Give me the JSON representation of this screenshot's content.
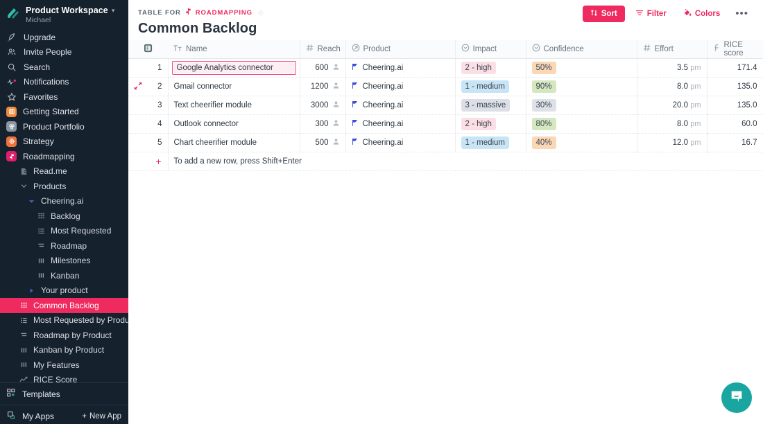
{
  "sidebar": {
    "workspace": {
      "title": "Product Workspace",
      "user": "Michael",
      "caret": "chevron-down-icon"
    },
    "nav": [
      {
        "label": "Upgrade",
        "icon": "rocket-icon"
      },
      {
        "label": "Invite People",
        "icon": "people-icon"
      },
      {
        "label": "Search",
        "icon": "search-icon"
      },
      {
        "label": "Notifications",
        "icon": "activity-icon"
      },
      {
        "label": "Favorites",
        "icon": "star-icon"
      }
    ],
    "apps": [
      {
        "label": "Getting Started",
        "icon": "book-icon",
        "color": "#f08a3c"
      },
      {
        "label": "Product Portfolio",
        "icon": "molecule-icon",
        "color": "#8b96a3"
      },
      {
        "label": "Strategy",
        "icon": "target-icon",
        "color": "#f0713c"
      },
      {
        "label": "Roadmapping",
        "icon": "roadmap-icon",
        "color": "#e01f6a"
      }
    ],
    "tree": [
      {
        "label": "Read.me",
        "icon": "doc-icon",
        "level": 1
      },
      {
        "label": "Products",
        "icon": "chevron-collapsed-icon",
        "level": 1
      },
      {
        "label": "Cheering.ai",
        "icon": "chevron-open-icon",
        "level": 2
      },
      {
        "label": "Backlog",
        "icon": "grid-icon",
        "level": 3
      },
      {
        "label": "Most Requested",
        "icon": "list-icon",
        "level": 3
      },
      {
        "label": "Roadmap",
        "icon": "roadmap-lines-icon",
        "level": 3
      },
      {
        "label": "Milestones",
        "icon": "bars-icon",
        "level": 3
      },
      {
        "label": "Kanban",
        "icon": "bars-icon",
        "level": 3
      },
      {
        "label": "Your product",
        "icon": "triangle-right-icon",
        "level": 2
      }
    ],
    "views": [
      {
        "label": "Common Backlog",
        "icon": "grid-icon",
        "selected": true
      },
      {
        "label": "Most Requested by Product",
        "icon": "list-icon",
        "selected": false
      },
      {
        "label": "Roadmap by Product",
        "icon": "roadmap-lines-icon",
        "selected": false
      },
      {
        "label": "Kanban by Product",
        "icon": "bars-icon",
        "selected": false
      },
      {
        "label": "My Features",
        "icon": "bars-icon",
        "selected": false
      },
      {
        "label": "RICE Score",
        "icon": "chart-line-icon",
        "selected": false
      }
    ],
    "bottom": {
      "templates": {
        "label": "Templates",
        "icon": "templates-icon"
      },
      "my_apps": {
        "label": "My Apps",
        "icon": "apps-icon"
      },
      "new_app": {
        "label": "New App",
        "icon": "plus-icon"
      }
    }
  },
  "header": {
    "breadcrumb_prefix": "TABLE FOR",
    "breadcrumb_app": "ROADMAPPING",
    "breadcrumb_app_icon": "roadmap-icon",
    "favorite_icon": "star-outline-icon",
    "title": "Common Backlog",
    "actions": {
      "sort": {
        "label": "Sort",
        "icon": "sort-icon"
      },
      "filter": {
        "label": "Filter",
        "icon": "filter-icon"
      },
      "colors": {
        "label": "Colors",
        "icon": "colors-icon"
      },
      "more": {
        "label": "•••",
        "icon": "more-icon"
      }
    }
  },
  "table": {
    "columns": [
      {
        "key": "handle",
        "label": "",
        "icon": "formula-badge-icon"
      },
      {
        "key": "name",
        "label": "Name",
        "icon": "text-type-icon"
      },
      {
        "key": "reach",
        "label": "Reach",
        "icon": "number-type-icon"
      },
      {
        "key": "product",
        "label": "Product",
        "icon": "link-type-icon"
      },
      {
        "key": "impact",
        "label": "Impact",
        "icon": "select-type-icon"
      },
      {
        "key": "confidence",
        "label": "Confidence",
        "icon": "select-type-icon"
      },
      {
        "key": "effort",
        "label": "Effort",
        "icon": "number-type-icon"
      },
      {
        "key": "rice",
        "label": "RICE score",
        "icon": "formula-type-icon"
      }
    ],
    "rows": [
      {
        "num": "1",
        "name": "Google Analytics connector",
        "reach": "600",
        "product": "Cheering.ai",
        "impact": "2 - high",
        "impact_style": "high",
        "confidence": "50%",
        "confidence_style": "c50",
        "effort": "3.5",
        "effort_unit": "pm",
        "rice": "171.4",
        "active": true,
        "expand": false
      },
      {
        "num": "2",
        "name": "Gmail connector",
        "reach": "1200",
        "product": "Cheering.ai",
        "impact": "1 - medium",
        "impact_style": "medium",
        "confidence": "90%",
        "confidence_style": "c90",
        "effort": "8.0",
        "effort_unit": "pm",
        "rice": "135.0",
        "active": false,
        "expand": true
      },
      {
        "num": "3",
        "name": "Text cheerifier module",
        "reach": "3000",
        "product": "Cheering.ai",
        "impact": "3 - massive",
        "impact_style": "massive",
        "confidence": "30%",
        "confidence_style": "c30",
        "effort": "20.0",
        "effort_unit": "pm",
        "rice": "135.0",
        "active": false,
        "expand": false
      },
      {
        "num": "4",
        "name": "Outlook connector",
        "reach": "300",
        "product": "Cheering.ai",
        "impact": "2 - high",
        "impact_style": "high",
        "confidence": "80%",
        "confidence_style": "c80",
        "effort": "8.0",
        "effort_unit": "pm",
        "rice": "60.0",
        "active": false,
        "expand": false
      },
      {
        "num": "5",
        "name": "Chart cheerifier module",
        "reach": "500",
        "product": "Cheering.ai",
        "impact": "1 - medium",
        "impact_style": "medium",
        "confidence": "40%",
        "confidence_style": "c40",
        "effort": "12.0",
        "effort_unit": "pm",
        "rice": "16.7",
        "active": false,
        "expand": false
      }
    ],
    "add_row": {
      "plus": "+",
      "hint": "To add a new row, press Shift+Enter"
    }
  },
  "chat": {
    "icon": "chat-bubble-icon"
  },
  "colors": {
    "accent": "#ef2a5f",
    "sidebar_bg": "#16212e",
    "chat_bg": "#1aa6a0"
  }
}
